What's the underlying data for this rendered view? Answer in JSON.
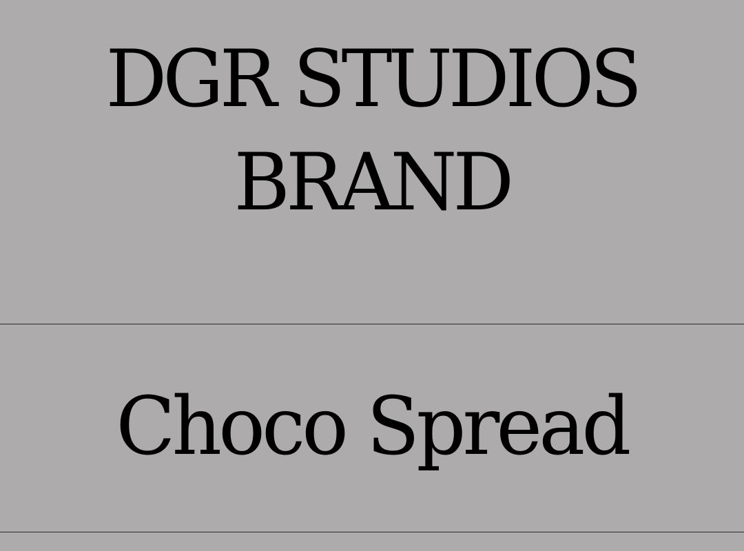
{
  "label": {
    "brand_line_1": "DGR STUDIOS",
    "brand_line_2": "BRAND",
    "product": "Choco Spread"
  },
  "colors": {
    "background": "#adabac",
    "text": "#000000",
    "divider": "#2a2a2a"
  }
}
